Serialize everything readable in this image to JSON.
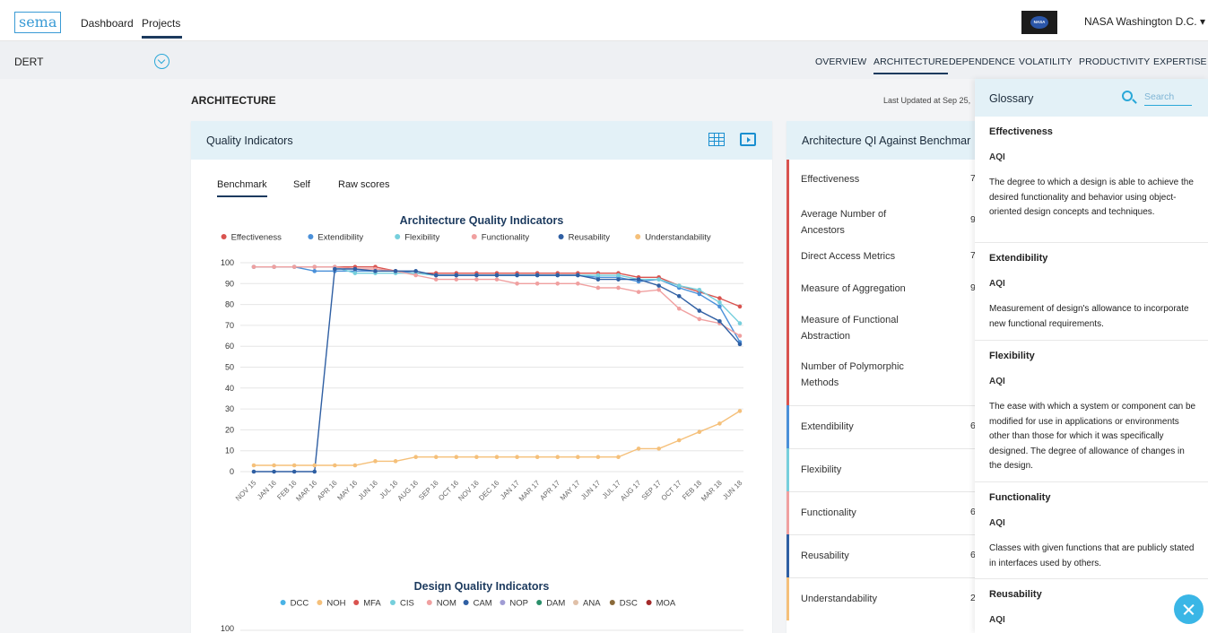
{
  "topnav": {
    "logo": "sema",
    "links": [
      {
        "label": "Dashboard"
      },
      {
        "label": "Projects"
      }
    ],
    "nasa_logo": "NASA",
    "org": "NASA Washington D.C. ▾"
  },
  "subbar": {
    "project": "DERT",
    "tabs": [
      {
        "label": "OVERVIEW"
      },
      {
        "label": "ARCHITECTURE"
      },
      {
        "label": "DEPENDENCE"
      },
      {
        "label": "VOLATILITY"
      },
      {
        "label": "PRODUCTIVITY"
      },
      {
        "label": "EXPERTISE"
      }
    ]
  },
  "main": {
    "title": "ARCHITECTURE",
    "updated": "Last Updated at Sep 25,"
  },
  "qi_card": {
    "title": "Quality Indicators",
    "tabs": [
      {
        "label": "Benchmark"
      },
      {
        "label": "Self"
      },
      {
        "label": "Raw scores"
      }
    ]
  },
  "chart_data": [
    {
      "type": "line",
      "title": "Architecture Quality Indicators",
      "ylim": [
        0,
        100
      ],
      "yticks": [
        0,
        10,
        20,
        30,
        40,
        50,
        60,
        70,
        80,
        90,
        100
      ],
      "grid": true,
      "legend": "top",
      "x": [
        "NOV 15",
        "JAN 16",
        "FEB 16",
        "MAR 16",
        "APR 16",
        "MAY 16",
        "JUN 16",
        "JUL 16",
        "AUG 16",
        "SEP 16",
        "OCT 16",
        "NOV 16",
        "DEC 16",
        "JAN 17",
        "MAR 17",
        "APR 17",
        "MAY 17",
        "JUN 17",
        "JUL 17",
        "AUG 17",
        "SEP 17",
        "OCT 17",
        "FEB 18",
        "MAR 18",
        "JUN 18"
      ],
      "series": [
        {
          "name": "Effectiveness",
          "color": "#d9534f",
          "values": [
            98,
            98,
            98,
            98,
            98,
            98,
            98,
            96,
            95,
            95,
            95,
            95,
            95,
            95,
            95,
            95,
            95,
            95,
            95,
            93,
            93,
            89,
            86,
            83,
            79
          ]
        },
        {
          "name": "Extendibility",
          "color": "#4a90d9",
          "values": [
            98,
            98,
            98,
            96,
            96,
            96,
            96,
            96,
            95,
            94,
            94,
            94,
            94,
            94,
            94,
            94,
            94,
            93,
            93,
            91,
            92,
            88,
            85,
            79,
            62
          ]
        },
        {
          "name": "Flexibility",
          "color": "#76cfdc",
          "values": [
            98,
            98,
            98,
            98,
            98,
            95,
            95,
            95,
            95,
            94,
            94,
            94,
            94,
            94,
            94,
            94,
            94,
            94,
            94,
            92,
            92,
            89,
            87,
            81,
            71
          ]
        },
        {
          "name": "Functionality",
          "color": "#f0a0a0",
          "values": [
            98,
            98,
            98,
            98,
            98,
            97,
            97,
            96,
            94,
            92,
            92,
            92,
            92,
            90,
            90,
            90,
            90,
            88,
            88,
            86,
            87,
            78,
            73,
            71,
            65
          ]
        },
        {
          "name": "Reusability",
          "color": "#2f5fa3",
          "values": [
            0,
            0,
            0,
            0,
            97,
            97,
            96,
            96,
            96,
            94,
            94,
            94,
            94,
            94,
            94,
            94,
            94,
            92,
            92,
            92,
            89,
            84,
            77,
            72,
            61
          ]
        },
        {
          "name": "Understandability",
          "color": "#f5c07a",
          "values": [
            3,
            3,
            3,
            3,
            3,
            3,
            5,
            5,
            7,
            7,
            7,
            7,
            7,
            7,
            7,
            7,
            7,
            7,
            7,
            11,
            11,
            15,
            19,
            23,
            29
          ]
        }
      ]
    },
    {
      "type": "line",
      "title": "Design Quality Indicators",
      "ylim": [
        0,
        100
      ],
      "yticks": [
        100
      ],
      "legend": "top",
      "series": [
        {
          "name": "DCC",
          "color": "#4ab3e6",
          "values": []
        },
        {
          "name": "NOH",
          "color": "#f5c07a",
          "values": []
        },
        {
          "name": "MFA",
          "color": "#d9534f",
          "values": []
        },
        {
          "name": "CIS",
          "color": "#76cfdc",
          "values": []
        },
        {
          "name": "NOM",
          "color": "#f0a0a0",
          "values": []
        },
        {
          "name": "CAM",
          "color": "#2f5fa3",
          "values": []
        },
        {
          "name": "NOP",
          "color": "#a09cd4",
          "values": []
        },
        {
          "name": "DAM",
          "color": "#2a8f6a",
          "values": []
        },
        {
          "name": "ANA",
          "color": "#e0c0a8",
          "values": []
        },
        {
          "name": "DSC",
          "color": "#8a6a3a",
          "values": []
        },
        {
          "name": "MOA",
          "color": "#a32a2a",
          "values": []
        }
      ]
    }
  ],
  "bench_card": {
    "title": "Architecture QI Against Benchmar",
    "rows": [
      {
        "label": "Effectiveness",
        "value": "7",
        "color": "#d9534f"
      },
      {
        "label": "Average Number of Ancestors",
        "value": "9",
        "color": "#d9534f"
      },
      {
        "label": "Direct Access Metrics",
        "value": "7",
        "color": "#d9534f"
      },
      {
        "label": "Measure of Aggregation",
        "value": "9",
        "color": "#d9534f"
      },
      {
        "label": "Measure of Functional Abstraction",
        "value": "",
        "color": "#d9534f"
      },
      {
        "label": "Number of Polymorphic Methods",
        "value": "",
        "color": "#d9534f"
      },
      {
        "label": "Extendibility",
        "value": "6",
        "color": "#4a90d9"
      },
      {
        "label": "Flexibility",
        "value": "",
        "color": "#76cfdc"
      },
      {
        "label": "Functionality",
        "value": "6",
        "color": "#f0a0a0"
      },
      {
        "label": "Reusability",
        "value": "6",
        "color": "#2f5fa3"
      },
      {
        "label": "Understandability",
        "value": "2",
        "color": "#f5c07a"
      }
    ]
  },
  "glossary": {
    "title": "Glossary",
    "search_placeholder": "Search",
    "entries": [
      {
        "term": "Effectiveness",
        "category": "AQI",
        "definition": "The degree to which a design is able to achieve the desired functionality and behavior using object-oriented design concepts and techniques."
      },
      {
        "term": "Extendibility",
        "category": "AQI",
        "definition": "Measurement of design's allowance to incorporate new functional requirements."
      },
      {
        "term": "Flexibility",
        "category": "AQI",
        "definition": "The ease with which a system or component can be modified for use in applications or environments other than those for which it was specifically designed. The degree of allowance of changes in the design."
      },
      {
        "term": "Functionality",
        "category": "AQI",
        "definition": "Classes with given functions that are publicly stated in interfaces used by others."
      },
      {
        "term": "Reusability",
        "category": "AQI",
        "definition": ""
      }
    ]
  }
}
